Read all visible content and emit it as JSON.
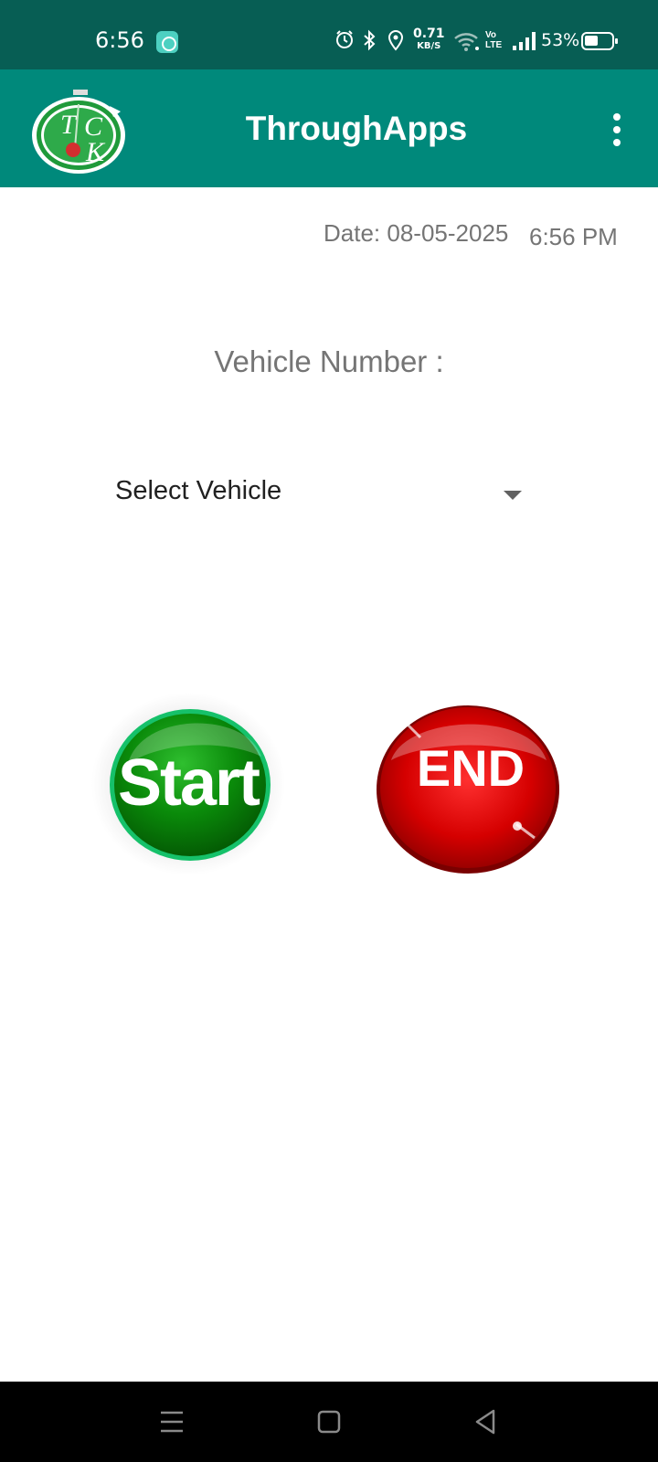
{
  "status_bar": {
    "time": "6:56",
    "speed_value": "0.71",
    "speed_unit": "KB/S",
    "volte_top": "Vo",
    "volte_bottom": "LTE",
    "battery_percent": "53%",
    "icons": [
      "app-notification-icon",
      "alarm-icon",
      "bluetooth-icon",
      "location-icon",
      "wifi-icon",
      "signal-icon",
      "battery-icon"
    ]
  },
  "app_bar": {
    "title": "ThroughApps",
    "logo_text_top": "T",
    "logo_text_c": "C",
    "logo_text_k": "K",
    "menu_icon": "more-vert-icon"
  },
  "main": {
    "date": "Date: 08-05-2025",
    "time": "6:56 PM",
    "vehicle_label": "Vehicle Number :",
    "vehicle_select": {
      "value": "Select Vehicle",
      "icon": "dropdown-arrow-icon"
    },
    "start_button": "Start",
    "end_button": "END"
  },
  "nav_bar": {
    "icons": [
      "recents-icon",
      "home-icon",
      "back-icon"
    ]
  },
  "colors": {
    "status_bar": "#075e54",
    "app_bar": "#00897b",
    "start_green": "#0a8a0a",
    "end_red": "#d50000"
  }
}
